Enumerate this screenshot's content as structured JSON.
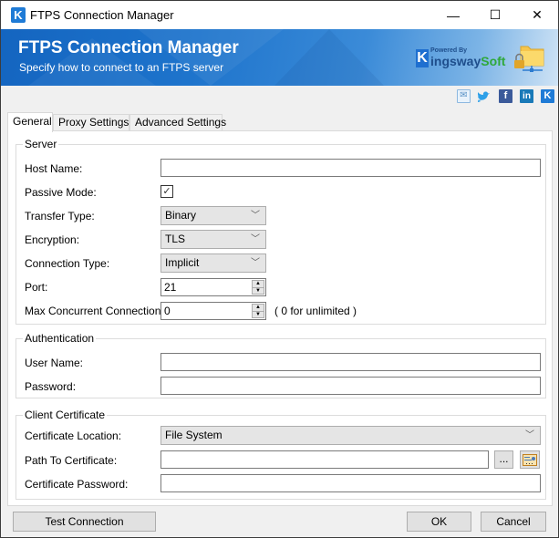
{
  "window": {
    "title": "FTPS Connection Manager",
    "app_icon": "K",
    "controls": {
      "minimize": "—",
      "maximize": "☐",
      "close": "✕"
    }
  },
  "header": {
    "title": "FTPS Connection Manager",
    "subtitle": "Specify how to connect to an FTPS server",
    "brand": {
      "powered_by": "Powered By",
      "k": "K",
      "name_main": "ingsway",
      "name_soft": "Soft"
    },
    "icon": "folder-lock-network-icon"
  },
  "social": {
    "mail": "✉",
    "twitter": "🐦",
    "facebook": "f",
    "linkedin": "in",
    "kingsway": "K"
  },
  "tabs": [
    {
      "label": "General",
      "active": true
    },
    {
      "label": "Proxy Settings",
      "active": false
    },
    {
      "label": "Advanced Settings",
      "active": false
    }
  ],
  "server": {
    "legend": "Server",
    "host_name": {
      "label": "Host Name:",
      "value": ""
    },
    "passive_mode": {
      "label": "Passive Mode:",
      "checked": true,
      "glyph": "✓"
    },
    "transfer_type": {
      "label": "Transfer Type:",
      "value": "Binary"
    },
    "encryption": {
      "label": "Encryption:",
      "value": "TLS"
    },
    "connection_type": {
      "label": "Connection Type:",
      "value": "Implicit"
    },
    "port": {
      "label": "Port:",
      "value": "21"
    },
    "max_connections": {
      "label": "Max Concurrent Connections:",
      "value": "0",
      "hint": "( 0 for unlimited )"
    }
  },
  "authentication": {
    "legend": "Authentication",
    "user_name": {
      "label": "User Name:",
      "value": ""
    },
    "password": {
      "label": "Password:",
      "value": ""
    }
  },
  "client_certificate": {
    "legend": "Client Certificate",
    "location": {
      "label": "Certificate Location:",
      "value": "File System"
    },
    "path": {
      "label": "Path To Certificate:",
      "value": "",
      "browse_label": "..."
    },
    "password": {
      "label": "Certificate Password:",
      "value": ""
    }
  },
  "footer": {
    "test_connection": "Test Connection",
    "ok": "OK",
    "cancel": "Cancel"
  },
  "glyphs": {
    "chevron": "﹀",
    "up": "▲",
    "down": "▼"
  }
}
